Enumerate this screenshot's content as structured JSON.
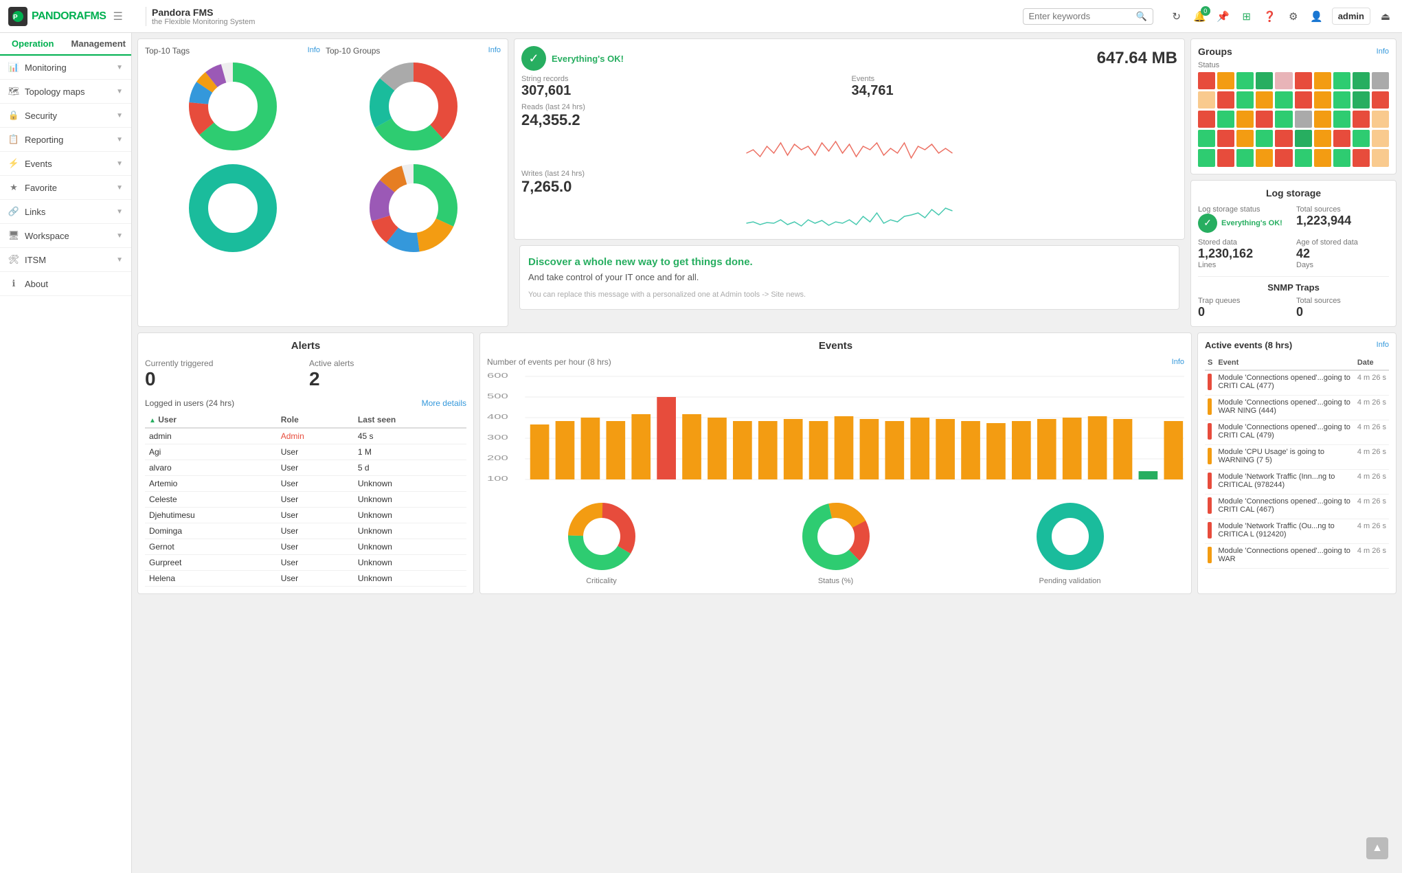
{
  "topbar": {
    "brand": "PANDORA",
    "brand_highlight": "FMS",
    "app_title": "Pandora FMS",
    "app_subtitle": "the Flexible Monitoring System",
    "search_placeholder": "Enter keywords",
    "user_label": "admin",
    "notification_count": "0"
  },
  "sidebar": {
    "tab_operation": "Operation",
    "tab_management": "Management",
    "items": [
      {
        "id": "monitoring",
        "label": "Monitoring"
      },
      {
        "id": "topology-maps",
        "label": "Topology maps"
      },
      {
        "id": "security",
        "label": "Security"
      },
      {
        "id": "reporting",
        "label": "Reporting"
      },
      {
        "id": "events",
        "label": "Events"
      },
      {
        "id": "favorite",
        "label": "Favorite"
      },
      {
        "id": "links",
        "label": "Links"
      },
      {
        "id": "workspace",
        "label": "Workspace"
      },
      {
        "id": "itsm",
        "label": "ITSM"
      },
      {
        "id": "about",
        "label": "About"
      }
    ]
  },
  "dashboard": {
    "top_tags_label": "Top-10 Tags",
    "top_groups_label": "Top-10 Groups",
    "info_label": "Info",
    "status_ok": "Everything's OK!",
    "disk_space": "647.64 MB",
    "string_records_label": "String records",
    "string_records": "307,601",
    "events_label": "Events",
    "events_count": "34,761",
    "reads_label": "Reads (last 24 hrs)",
    "reads_value": "24,355.2",
    "writes_label": "Writes (last 24 hrs)",
    "writes_value": "7,265.0",
    "groups_title": "Groups",
    "status_label": "Status",
    "log_storage_title": "Log storage",
    "log_storage_status_label": "Log storage status",
    "log_storage_ok": "Everything's OK!",
    "total_sources_label": "Total sources",
    "total_sources_value": "1,223,944",
    "stored_data_label": "Stored data",
    "stored_data_value": "1,230,162",
    "stored_data_unit": "Lines",
    "age_label": "Age of stored data",
    "age_value": "42",
    "age_unit": "Days",
    "snmp_title": "SNMP Traps",
    "trap_queues_label": "Trap queues",
    "trap_queues_value": "0",
    "total_sources_snmp_label": "Total sources",
    "total_sources_snmp_value": "0",
    "alerts_title": "Alerts",
    "currently_triggered_label": "Currently triggered",
    "currently_triggered_value": "0",
    "active_alerts_label": "Active alerts",
    "active_alerts_value": "2",
    "logged_users_label": "Logged in users (24 hrs)",
    "more_details_label": "More details",
    "users_col_user": "User",
    "users_col_role": "Role",
    "users_col_last": "Last seen",
    "users": [
      {
        "name": "admin",
        "role": "Admin",
        "role_type": "admin",
        "last": "45 s"
      },
      {
        "name": "Agi",
        "role": "User",
        "role_type": "user",
        "last": "1 M"
      },
      {
        "name": "alvaro",
        "role": "User",
        "role_type": "user",
        "last": "5 d"
      },
      {
        "name": "Artemio",
        "role": "User",
        "role_type": "user",
        "last": "Unknown"
      },
      {
        "name": "Celeste",
        "role": "User",
        "role_type": "user",
        "last": "Unknown"
      },
      {
        "name": "Djehutimesu",
        "role": "User",
        "role_type": "user",
        "last": "Unknown"
      },
      {
        "name": "Dominga",
        "role": "User",
        "role_type": "user",
        "last": "Unknown"
      },
      {
        "name": "Gernot",
        "role": "User",
        "role_type": "user",
        "last": "Unknown"
      },
      {
        "name": "Gurpreet",
        "role": "User",
        "role_type": "user",
        "last": "Unknown"
      },
      {
        "name": "Helena",
        "role": "User",
        "role_type": "user",
        "last": "Unknown"
      }
    ],
    "events_title": "Events",
    "events_per_hour_label": "Number of events per hour (8 hrs)",
    "criticality_label": "Criticality",
    "status_pct_label": "Status (%)",
    "pending_validation_label": "Pending validation",
    "active_events_label": "Active events (8 hrs)",
    "ae_col_s": "S",
    "ae_col_event": "Event",
    "ae_col_date": "Date",
    "active_events": [
      {
        "severity": "critical",
        "text": "Module 'Connections opened'...going to CRITI CAL (477)",
        "time": "4 m 26 s"
      },
      {
        "severity": "warning",
        "text": "Module 'Connections opened'...going to WAR NING (444)",
        "time": "4 m 26 s"
      },
      {
        "severity": "critical",
        "text": "Module 'Connections opened'...going to CRITI CAL (479)",
        "time": "4 m 26 s"
      },
      {
        "severity": "warning",
        "text": "Module 'CPU Usage' is going to WARNING (7 5)",
        "time": "4 m 26 s"
      },
      {
        "severity": "critical",
        "text": "Module 'Network Traffic (Inn...ng to CRITICAL (978244)",
        "time": "4 m 26 s"
      },
      {
        "severity": "critical",
        "text": "Module 'Connections opened'...going to CRITI CAL (467)",
        "time": "4 m 26 s"
      },
      {
        "severity": "critical",
        "text": "Module 'Network Traffic (Ou...ng to CRITICA L (912420)",
        "time": "4 m 26 s"
      },
      {
        "severity": "warning",
        "text": "Module 'Connections opened'...going to WAR",
        "time": "4 m 26 s"
      }
    ],
    "welcome_bold": "Discover a whole new way to get things done.",
    "welcome_body": "And take control of your IT once and for all.",
    "welcome_note": "You can replace this message with a personalized one at Admin tools -> Site news."
  }
}
